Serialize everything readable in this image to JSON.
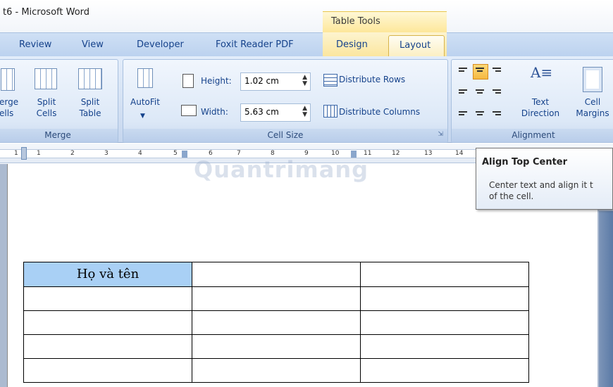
{
  "window": {
    "title": "t6 - Microsoft Word",
    "context_header": "Table Tools"
  },
  "tabs": [
    {
      "label": "Review"
    },
    {
      "label": "View"
    },
    {
      "label": "Developer"
    },
    {
      "label": "Foxit Reader PDF"
    },
    {
      "label": "Design"
    },
    {
      "label": "Layout"
    }
  ],
  "ribbon": {
    "merge": {
      "label": "Merge",
      "merge_cells": "erge\nells",
      "split_cells": "Split\nCells",
      "split_table": "Split\nTable"
    },
    "cell_size": {
      "label": "Cell Size",
      "autofit": "AutoFit",
      "height_label": "Height:",
      "height_value": "1.02 cm",
      "width_label": "Width:",
      "width_value": "5.63 cm",
      "distribute_rows": "Distribute Rows",
      "distribute_columns": "Distribute Columns"
    },
    "alignment": {
      "label": "Alignment",
      "text_direction": "Text\nDirection",
      "cell_margins": "Cell\nMargins",
      "selected": "align-top-center"
    }
  },
  "ruler": {
    "numbers": [
      "1",
      "1",
      "2",
      "3",
      "4",
      "5",
      "6",
      "7",
      "8",
      "9",
      "10",
      "11",
      "12",
      "13",
      "14"
    ]
  },
  "watermark": "Quantrimang",
  "tooltip": {
    "title": "Align Top Center",
    "body": "Center text and align it t\nof the cell."
  },
  "document": {
    "table": [
      [
        "Họ và tên",
        "",
        ""
      ],
      [
        "",
        "",
        ""
      ],
      [
        "",
        "",
        ""
      ],
      [
        "",
        "",
        ""
      ],
      [
        "",
        "",
        ""
      ]
    ]
  },
  "colors": {
    "accent": "#15428b",
    "selected_cell": "#a9d0f5",
    "context_tab": "#fbe69f"
  }
}
